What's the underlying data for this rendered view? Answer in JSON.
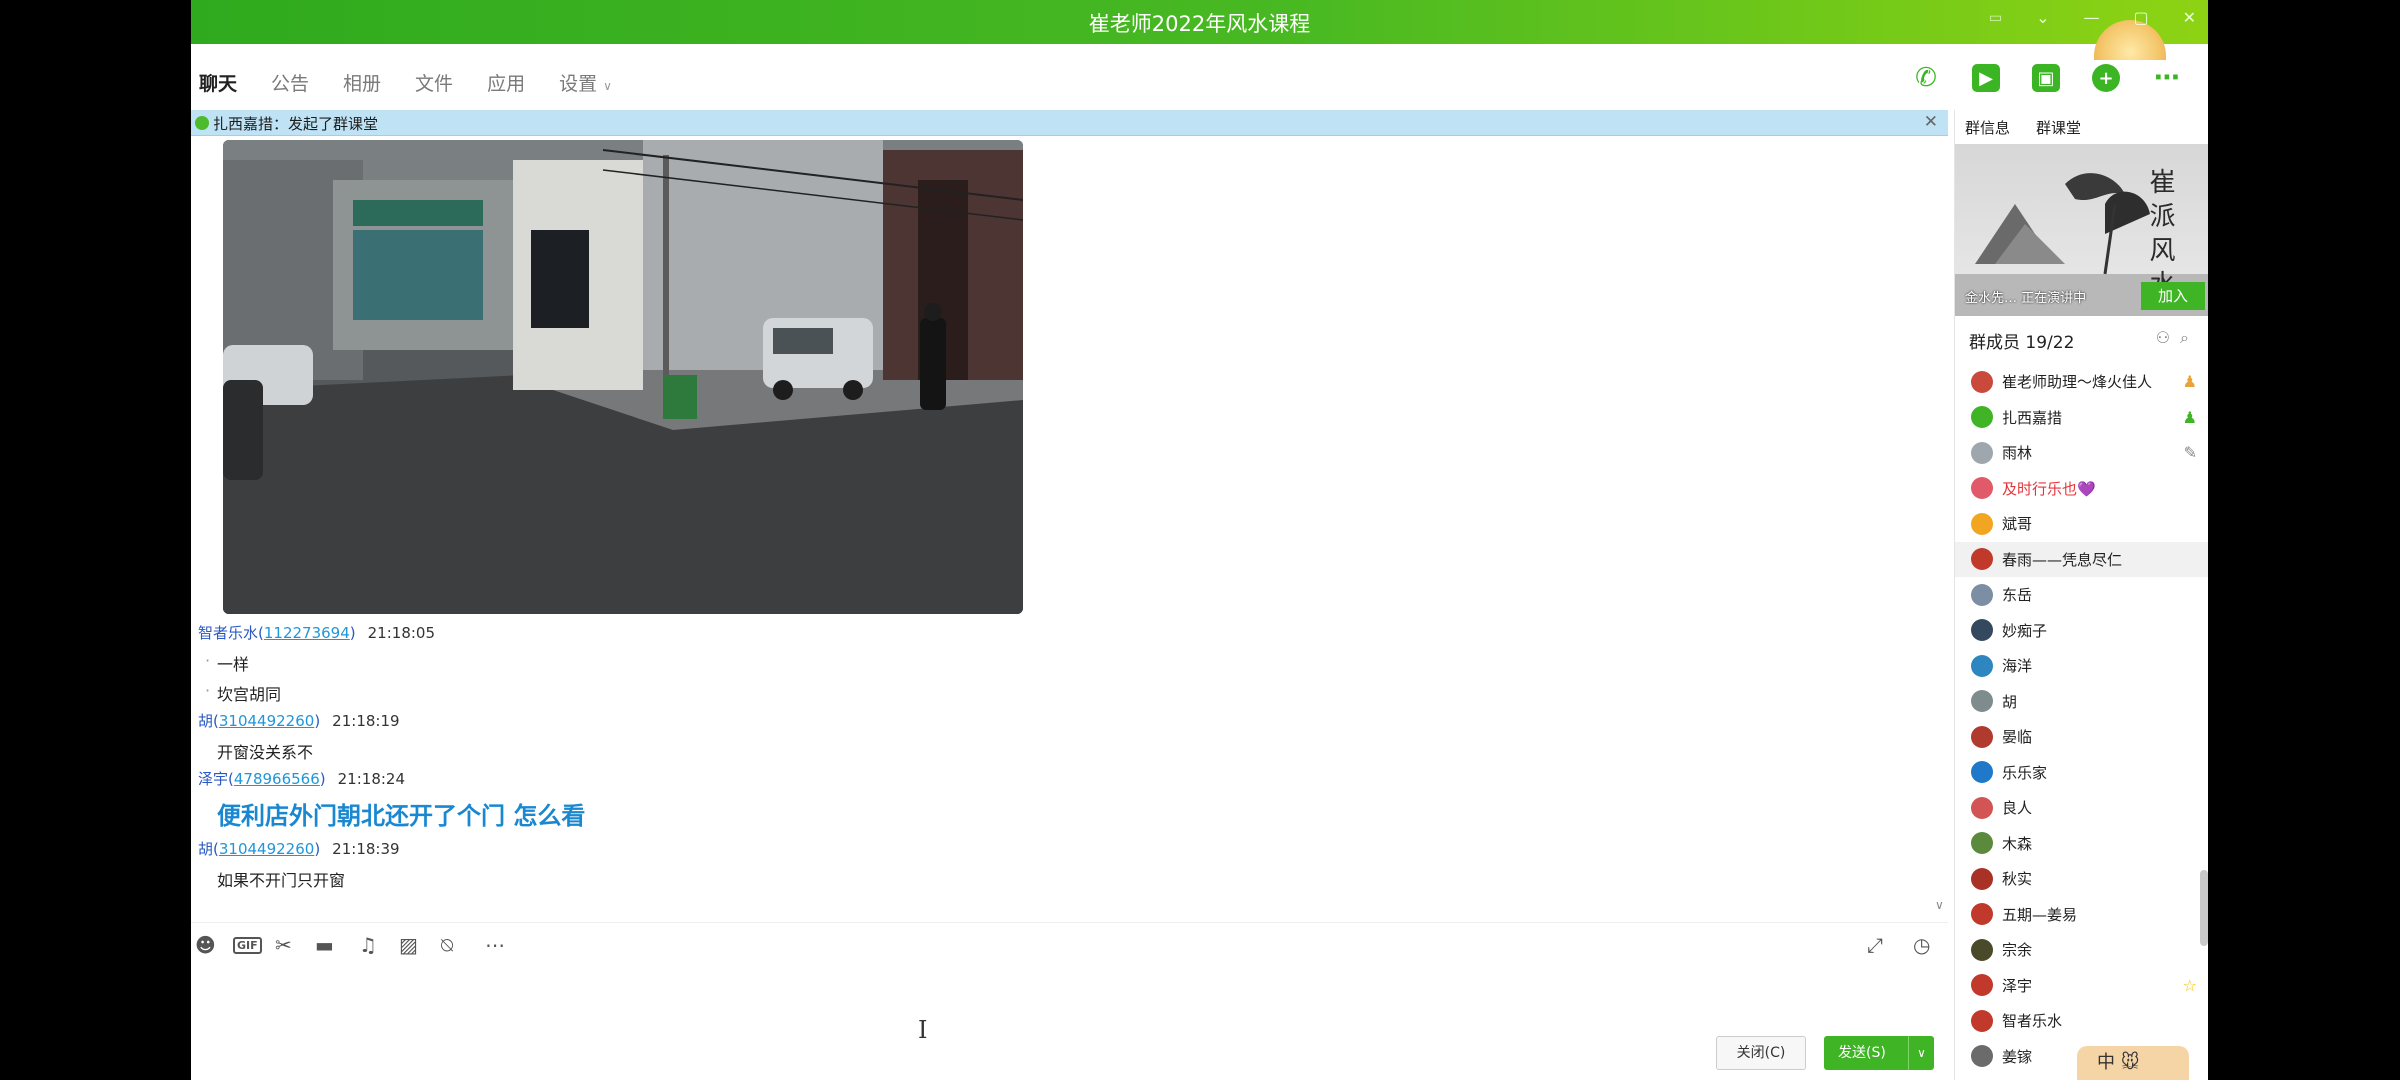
{
  "window": {
    "title": "崔老师2022年风水课程"
  },
  "tabs": [
    {
      "label": "聊天"
    },
    {
      "label": "公告"
    },
    {
      "label": "相册"
    },
    {
      "label": "文件"
    },
    {
      "label": "应用"
    },
    {
      "label": "设置"
    }
  ],
  "notice": {
    "user": "扎西嘉措",
    "sep": "：",
    "text": "发起了群课堂"
  },
  "messages": [
    {
      "sender": "智者乐水",
      "qq": "112273694",
      "time": "21:18:05",
      "lines": [
        "一样",
        "坎宫胡同"
      ]
    },
    {
      "sender": "胡",
      "qq": "3104492260",
      "time": "21:18:19",
      "lines": [
        "开窗没关系不"
      ]
    },
    {
      "sender": "泽宇",
      "qq": "478966566",
      "time": "21:18:24",
      "lines": [
        "便利店外门朝北还开了个门 怎么看"
      ]
    },
    {
      "sender": "胡",
      "qq": "3104492260",
      "time": "21:18:39",
      "lines": [
        "如果不开门只开窗"
      ]
    }
  ],
  "buttons": {
    "close": "关闭(C)",
    "send": "发送(S)"
  },
  "panel": {
    "tabs": [
      "群信息",
      "群课堂"
    ],
    "banner_calligraphy": "崔派风水",
    "banner_status": "金水先…  正在演讲中",
    "join": "加入",
    "members_title": "群成员 19/22"
  },
  "members": [
    {
      "name": "崔老师助理～烽火佳人",
      "color": "#c94a3c",
      "badge": "owner"
    },
    {
      "name": "扎西嘉措",
      "color": "#3fb424",
      "badge": "admin"
    },
    {
      "name": "雨林",
      "color": "#9fa7ae",
      "badge": "edit"
    },
    {
      "name": "及时行乐也💜",
      "color": "#e05a6a",
      "red": true
    },
    {
      "name": "斌哥",
      "color": "#f2a520"
    },
    {
      "name": "春雨——凭息尽仁",
      "color": "#c0392b",
      "hl": true
    },
    {
      "name": "东岳",
      "color": "#7b8ea3"
    },
    {
      "name": "妙痴子",
      "color": "#34495e"
    },
    {
      "name": "海洋",
      "color": "#2e86c1"
    },
    {
      "name": "胡",
      "color": "#7f8c8d"
    },
    {
      "name": "晏临",
      "color": "#b03a2e"
    },
    {
      "name": "乐乐家",
      "color": "#1f78c8"
    },
    {
      "name": "良人",
      "color": "#d35454"
    },
    {
      "name": "木森",
      "color": "#5b8a3c"
    },
    {
      "name": "秋实",
      "color": "#a93226"
    },
    {
      "name": "五期—姜易",
      "color": "#c0392b"
    },
    {
      "name": "宗余",
      "color": "#4a4a2a"
    },
    {
      "name": "泽宇",
      "color": "#c0392b",
      "badge": "star"
    },
    {
      "name": "智者乐水",
      "color": "#c0392b"
    },
    {
      "name": "姜镓",
      "color": "#6b6b6b"
    }
  ],
  "ime": "中 🐭",
  "colors": {
    "accent": "#3fb424",
    "link": "#1f96d8",
    "notice_bg": "#bfe3f5"
  }
}
